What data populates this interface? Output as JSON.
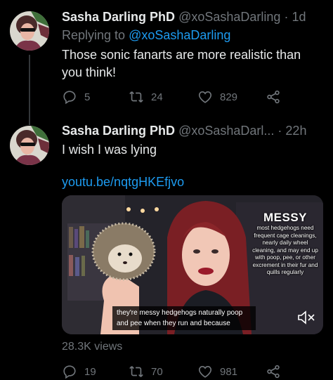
{
  "tweets": [
    {
      "author_name": "Sasha Darling PhD",
      "handle": "@xoSashaDarling",
      "separator": "·",
      "time": "1d",
      "replying_prefix": "Replying to",
      "replying_to": "@xoSashaDarling",
      "text": "Those sonic fanarts are more realistic than you think!",
      "replies": "5",
      "retweets": "24",
      "likes": "829"
    },
    {
      "author_name": "Sasha Darling PhD",
      "handle": "@xoSashaDarl...",
      "separator": "·",
      "time": "22h",
      "text": "I wish I was lying",
      "link": "youtu.be/nqtgHKEfjvo",
      "video": {
        "overlay_title": "MESSY",
        "overlay_text": "most hedgehogs need frequent cage cleanings, nearly daily wheel cleaning, and may end up with poop, pee, or other excrement in their fur and quills regularly",
        "caption_line1": "they're messy hedgehogs naturally poop",
        "caption_line2": "and pee when they run and because"
      },
      "views": "28.3K views",
      "replies": "19",
      "retweets": "70",
      "likes": "981"
    }
  ],
  "colors": {
    "background": "#000000",
    "text": "#e7e9ea",
    "muted": "#71767b",
    "link": "#1d9bf0"
  },
  "icons": [
    "reply-icon",
    "retweet-icon",
    "like-icon",
    "share-icon",
    "mute-icon"
  ]
}
